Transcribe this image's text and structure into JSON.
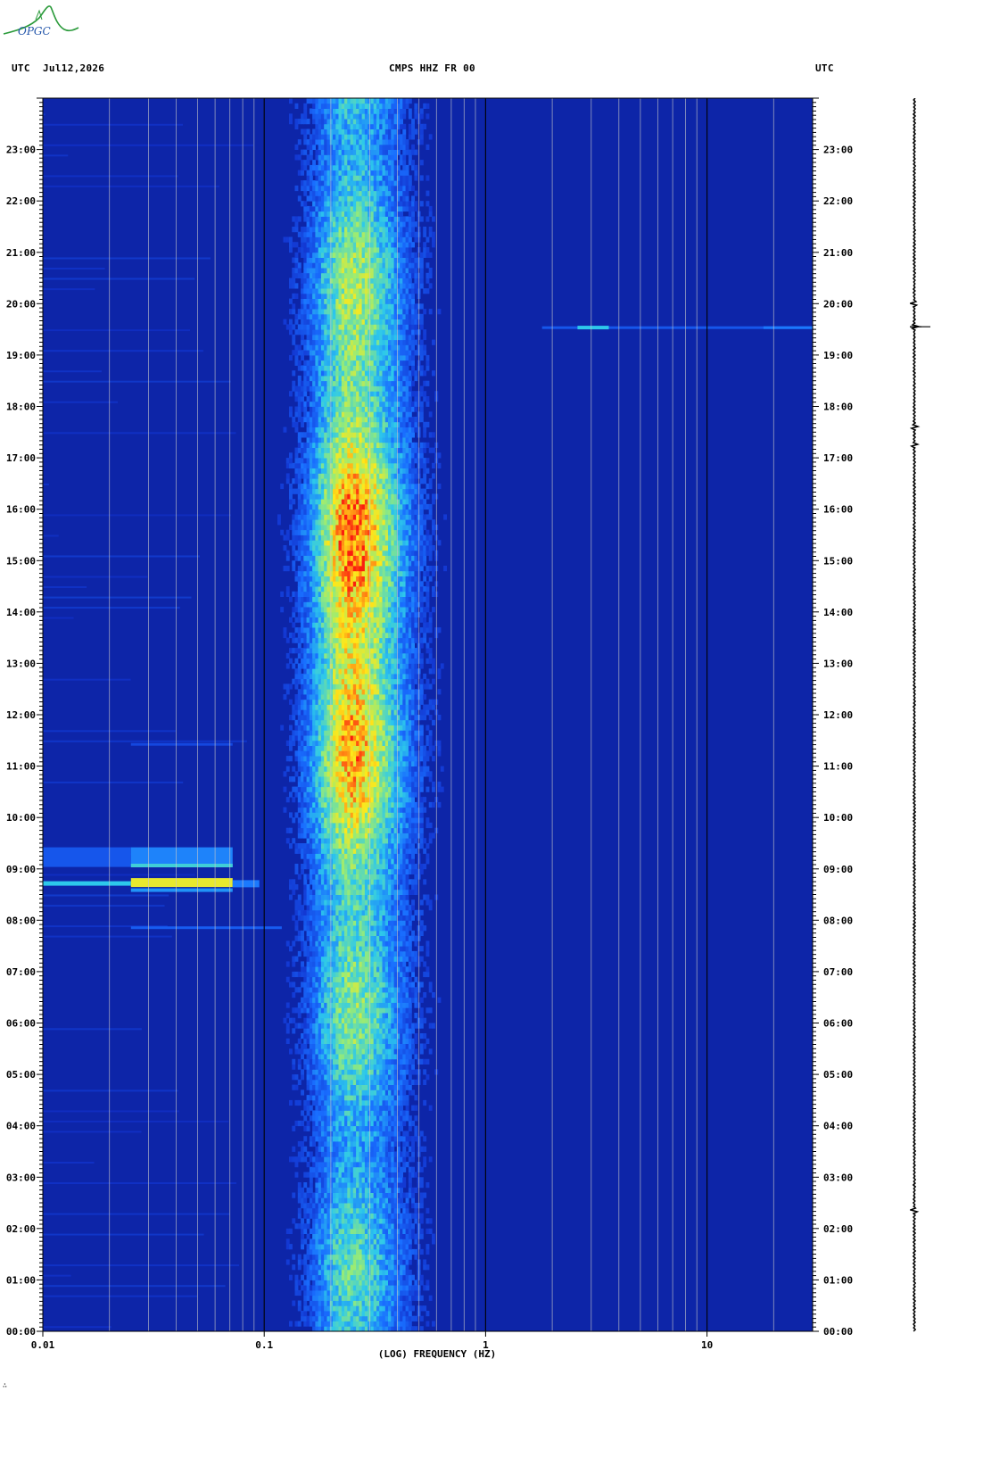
{
  "header": {
    "left_tz": "UTC",
    "date": "Jul12,2026",
    "station": "CMPS HHZ FR 00",
    "right_tz": "UTC"
  },
  "logo": {
    "text": "OPGC",
    "color": "#2a9a3a",
    "text_color": "#2255aa"
  },
  "colors": {
    "background_low": "#0a1e96",
    "mid": "#1a73ff",
    "cyan": "#32d2e6",
    "yellow": "#ffe61a",
    "red": "#ff2814",
    "grid": "#c8c8c8",
    "decade": "#000000"
  },
  "chart_data": {
    "type": "heatmap",
    "title": "CMPS HHZ FR 00",
    "xlabel": "(LOG) FREQUENCY (HZ)",
    "x_scale": "log",
    "xlim": [
      0.01,
      30
    ],
    "x_ticks": [
      0.01,
      0.1,
      1,
      10
    ],
    "x_tick_labels": [
      "0.01",
      "0.1",
      "1",
      "10"
    ],
    "ylabel": "UTC",
    "ylim_hours": [
      0,
      24
    ],
    "y_tick_labels": [
      "00:00",
      "01:00",
      "02:00",
      "03:00",
      "04:00",
      "05:00",
      "06:00",
      "07:00",
      "08:00",
      "09:00",
      "10:00",
      "11:00",
      "12:00",
      "13:00",
      "14:00",
      "15:00",
      "16:00",
      "17:00",
      "18:00",
      "19:00",
      "20:00",
      "21:00",
      "22:00",
      "23:00"
    ],
    "microseism_band_hz": [
      0.12,
      0.55
    ],
    "microseism_peak_hz": 0.25,
    "features": [
      {
        "type": "long-period transient",
        "time_hours": 8.7,
        "freq_range_hz": [
          0.01,
          0.09
        ]
      },
      {
        "type": "long-period transient",
        "time_hours": 9.1,
        "freq_range_hz": [
          0.025,
          0.09
        ]
      },
      {
        "type": "high-frequency burst",
        "time_hours": 19.55,
        "freq_range_hz": [
          1.8,
          30
        ]
      }
    ],
    "trace_events_hours": [
      19.55,
      17.6,
      17.25,
      20.0,
      2.35
    ]
  },
  "footer": {
    "mark": "∴"
  }
}
